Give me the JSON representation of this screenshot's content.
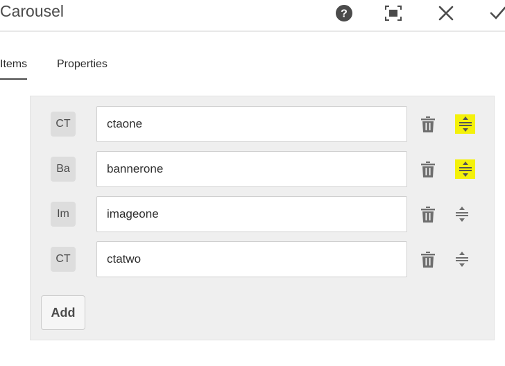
{
  "dialog": {
    "title": "Carousel",
    "toolbar_icons": [
      "help-icon",
      "fullscreen-icon",
      "close-icon",
      "done-icon"
    ]
  },
  "tabs": [
    {
      "label": "Items",
      "active": true
    },
    {
      "label": "Properties",
      "active": false
    }
  ],
  "items": [
    {
      "badge": "CT",
      "value": "ctaone",
      "reorder_highlighted": true
    },
    {
      "badge": "Ba",
      "value": "bannerone",
      "reorder_highlighted": true
    },
    {
      "badge": "Im",
      "value": "imageone",
      "reorder_highlighted": false
    },
    {
      "badge": "CT",
      "value": "ctatwo",
      "reorder_highlighted": false
    }
  ],
  "add_button": {
    "label": "Add"
  },
  "colors": {
    "highlight": "#f4f10a",
    "icon": "#6e6e6e",
    "panel": "#efefef"
  }
}
